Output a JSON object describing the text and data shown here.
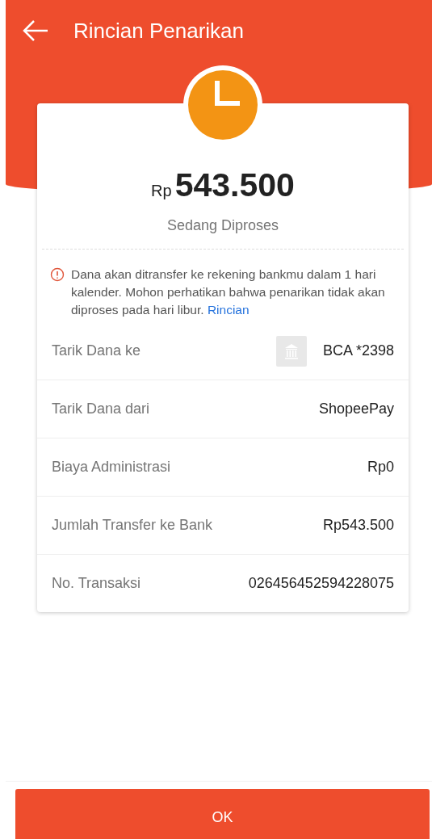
{
  "header": {
    "title": "Rincian Penarikan"
  },
  "summary": {
    "currency": "Rp",
    "amount": "543.500",
    "status": "Sedang Diproses"
  },
  "notice": {
    "text": "Dana akan ditransfer ke rekening bankmu dalam 1 hari kalender. Mohon perhatikan bahwa penarikan tidak akan diproses pada hari libur.",
    "link": "Rincian"
  },
  "details": [
    {
      "kind": "bank",
      "label": "Tarik Dana ke",
      "value": "BCA *2398"
    },
    {
      "kind": "plain",
      "label": "Tarik Dana dari",
      "value": "ShopeePay"
    },
    {
      "kind": "plain",
      "label": "Biaya Administrasi",
      "value": "Rp0"
    },
    {
      "kind": "plain",
      "label": "Jumlah Transfer ke Bank",
      "value": "Rp543.500"
    },
    {
      "kind": "plain",
      "label": "No. Transaksi",
      "value": "026456452594228075"
    }
  ],
  "buttons": [
    {
      "label": "OK"
    }
  ]
}
